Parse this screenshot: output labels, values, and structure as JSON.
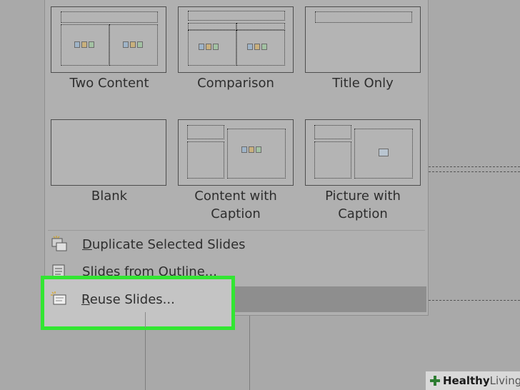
{
  "layouts": [
    {
      "label": "Two Content"
    },
    {
      "label": "Comparison"
    },
    {
      "label": "Title Only"
    },
    {
      "label": "Blank"
    },
    {
      "label_line1": "Content with",
      "label_line2": "Caption"
    },
    {
      "label_line1": "Picture with",
      "label_line2": "Caption"
    }
  ],
  "menu_items": [
    {
      "pre": "",
      "ul": "D",
      "post": "uplicate Selected Slides"
    },
    {
      "pre": "",
      "ul": "S",
      "post": "lides from Outline..."
    },
    {
      "pre": "",
      "ul": "R",
      "post": "euse Slides..."
    }
  ],
  "watermark": {
    "bold": "Healthy",
    "thin": "Living"
  },
  "colors": {
    "highlight": "#32e632",
    "watermark_logo": "#2e7d32"
  }
}
